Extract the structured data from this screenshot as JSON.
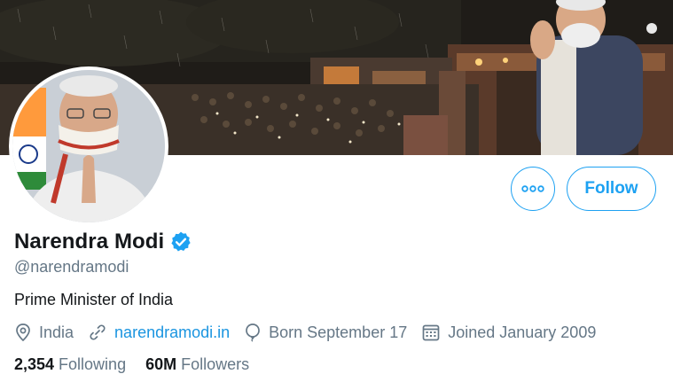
{
  "profile": {
    "name": "Narendra Modi",
    "handle": "@narendramodi",
    "bio": "Prime Minister of India",
    "location": "India",
    "website": "narendramodi.in",
    "birthday": "Born September 17",
    "joined": "Joined January 2009",
    "verified": true
  },
  "actions": {
    "follow_label": "Follow",
    "more_icon": "more-horizontal-icon"
  },
  "stats": {
    "following_count": "2,354",
    "following_label": "Following",
    "followers_count": "60M",
    "followers_label": "Followers"
  },
  "colors": {
    "accent": "#1da1f2",
    "link": "#1b95e0",
    "secondary_text": "#657786",
    "primary_text": "#14171a"
  }
}
